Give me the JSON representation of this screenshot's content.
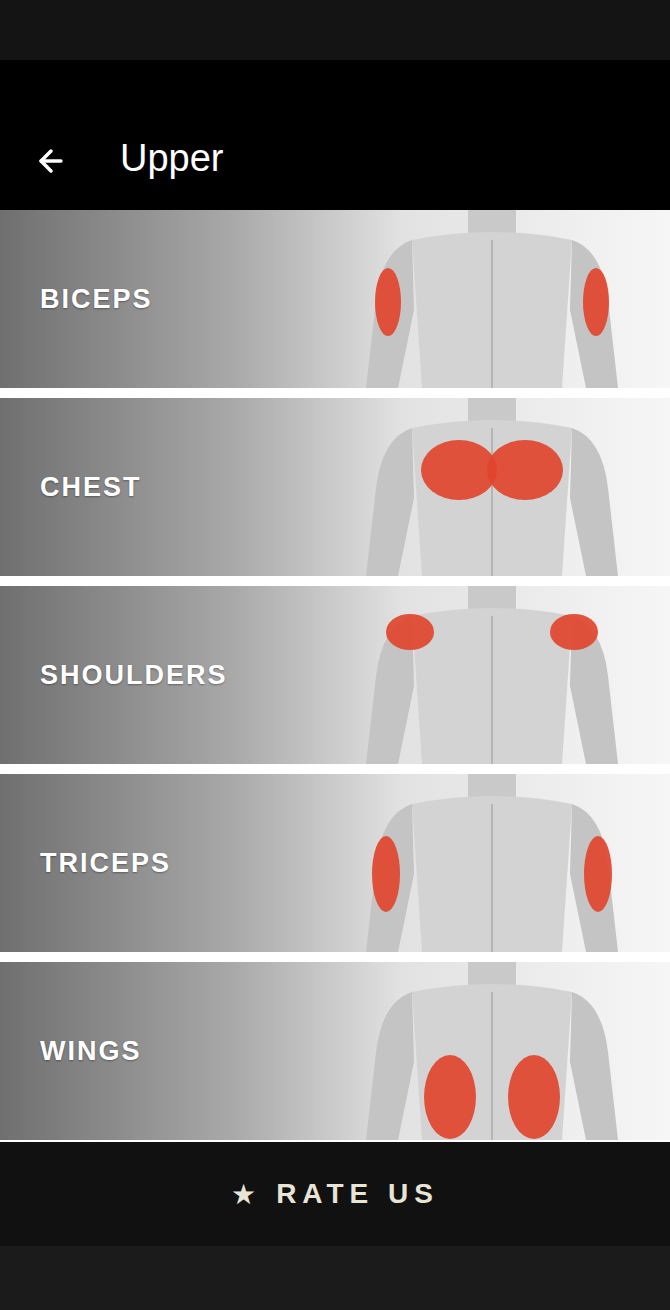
{
  "header": {
    "title": "Upper"
  },
  "muscles": [
    {
      "label": "BICEPS",
      "kind": "biceps"
    },
    {
      "label": "CHEST",
      "kind": "chest"
    },
    {
      "label": "SHOULDERS",
      "kind": "shoulders"
    },
    {
      "label": "TRICEPS",
      "kind": "triceps"
    },
    {
      "label": "WINGS",
      "kind": "wings"
    }
  ],
  "footer": {
    "star": "★",
    "label": "RATE US"
  }
}
